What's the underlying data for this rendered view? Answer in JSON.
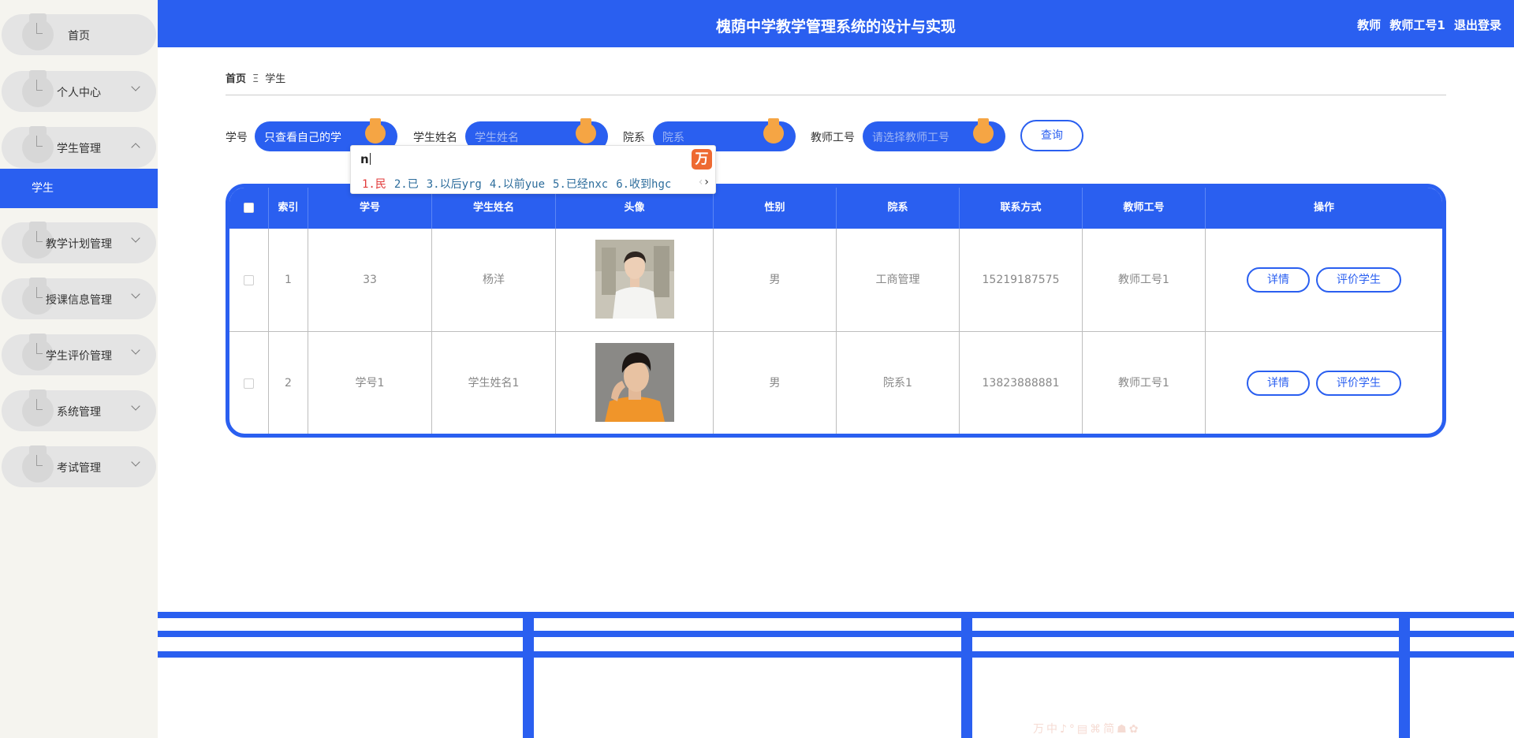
{
  "header": {
    "title": "槐荫中学教学管理系统的设计与实现",
    "user_role": "教师",
    "user_name": "教师工号1",
    "logout_label": "退出登录"
  },
  "sidebar": {
    "items": [
      {
        "label": "首页",
        "has_arrow": false
      },
      {
        "label": "个人中心",
        "has_arrow": true
      },
      {
        "label": "学生管理",
        "has_arrow": true,
        "expanded": true
      },
      {
        "label": "教学计划管理",
        "has_arrow": true
      },
      {
        "label": "授课信息管理",
        "has_arrow": true
      },
      {
        "label": "学生评价管理",
        "has_arrow": true
      },
      {
        "label": "系统管理",
        "has_arrow": true
      },
      {
        "label": "考试管理",
        "has_arrow": true
      }
    ],
    "subitem_active": "学生"
  },
  "breadcrumb": {
    "home": "首页",
    "separator": "Ξ",
    "current": "学生"
  },
  "search": {
    "student_no_label": "学号",
    "student_no_value": "只查看自己的学",
    "student_name_label": "学生姓名",
    "student_name_placeholder": "学生姓名",
    "department_label": "院系",
    "department_placeholder": "院系",
    "teacher_no_label": "教师工号",
    "teacher_no_placeholder": "请选择教师工号",
    "query_label": "查询"
  },
  "ime": {
    "composition": "n",
    "candidates": [
      "1.民",
      "2.已",
      "3.以后yrg",
      "4.以前yue",
      "5.已经nxc",
      "6.收到hgc"
    ],
    "logo": "万"
  },
  "table": {
    "columns": [
      "",
      "索引",
      "学号",
      "学生姓名",
      "头像",
      "性别",
      "院系",
      "联系方式",
      "教师工号",
      "操作"
    ],
    "rows": [
      {
        "index": "1",
        "student_no": "33",
        "name": "杨洋",
        "gender": "男",
        "department": "工商管理",
        "phone": "15219187575",
        "teacher_no": "教师工号1"
      },
      {
        "index": "2",
        "student_no": "学号1",
        "name": "学生姓名1",
        "gender": "男",
        "department": "院系1",
        "phone": "13823888881",
        "teacher_no": "教师工号1"
      }
    ],
    "detail_label": "详情",
    "evaluate_label": "评价学生"
  },
  "tray": {
    "text": "万中♪°▤⌘简☗✿"
  },
  "colors": {
    "primary": "#2a5ff0",
    "sidebar_bg": "#f5f4ef",
    "menu_pill": "#e4e4e4",
    "badge_orange": "#f5a544"
  }
}
